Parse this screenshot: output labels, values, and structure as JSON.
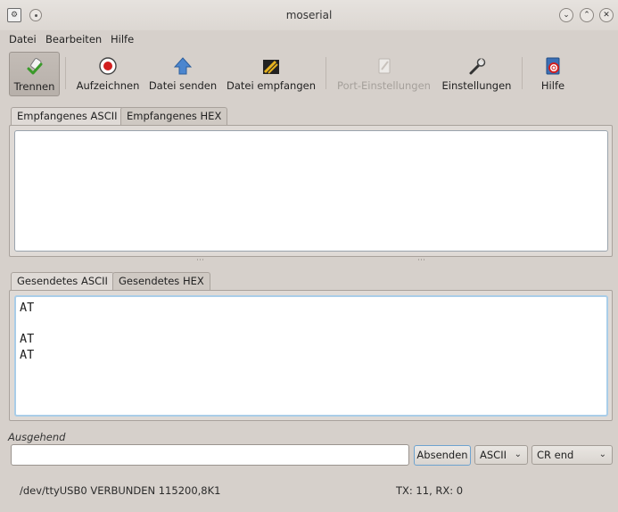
{
  "window": {
    "title": "moserial"
  },
  "menu": [
    "Datei",
    "Bearbeiten",
    "Hilfe"
  ],
  "toolbar": {
    "disconnect": "Trennen",
    "record": "Aufzeichnen",
    "send_file": "Datei senden",
    "receive_file": "Datei empfangen",
    "port_settings": "Port-Einstellungen",
    "settings": "Einstellungen",
    "help": "Hilfe"
  },
  "received": {
    "tab_ascii": "Empfangenes ASCII",
    "tab_hex": "Empfangenes HEX",
    "text": ""
  },
  "sent": {
    "tab_ascii": "Gesendetes ASCII",
    "tab_hex": "Gesendetes HEX",
    "text": "AT\n\nAT\nAT"
  },
  "outgoing": {
    "label": "Ausgehend",
    "value": "",
    "send_button": "Absenden",
    "format_selected": "ASCII",
    "line_end_selected": "CR end"
  },
  "status": {
    "connection": "/dev/ttyUSB0 VERBUNDEN 115200,8K1",
    "counters": "TX: 11, RX: 0"
  },
  "colors": {
    "window_bg": "#d6d0cb",
    "focus_border": "#a9cde8",
    "record_red": "#d21f1f",
    "check_green": "#3a9a2a"
  }
}
